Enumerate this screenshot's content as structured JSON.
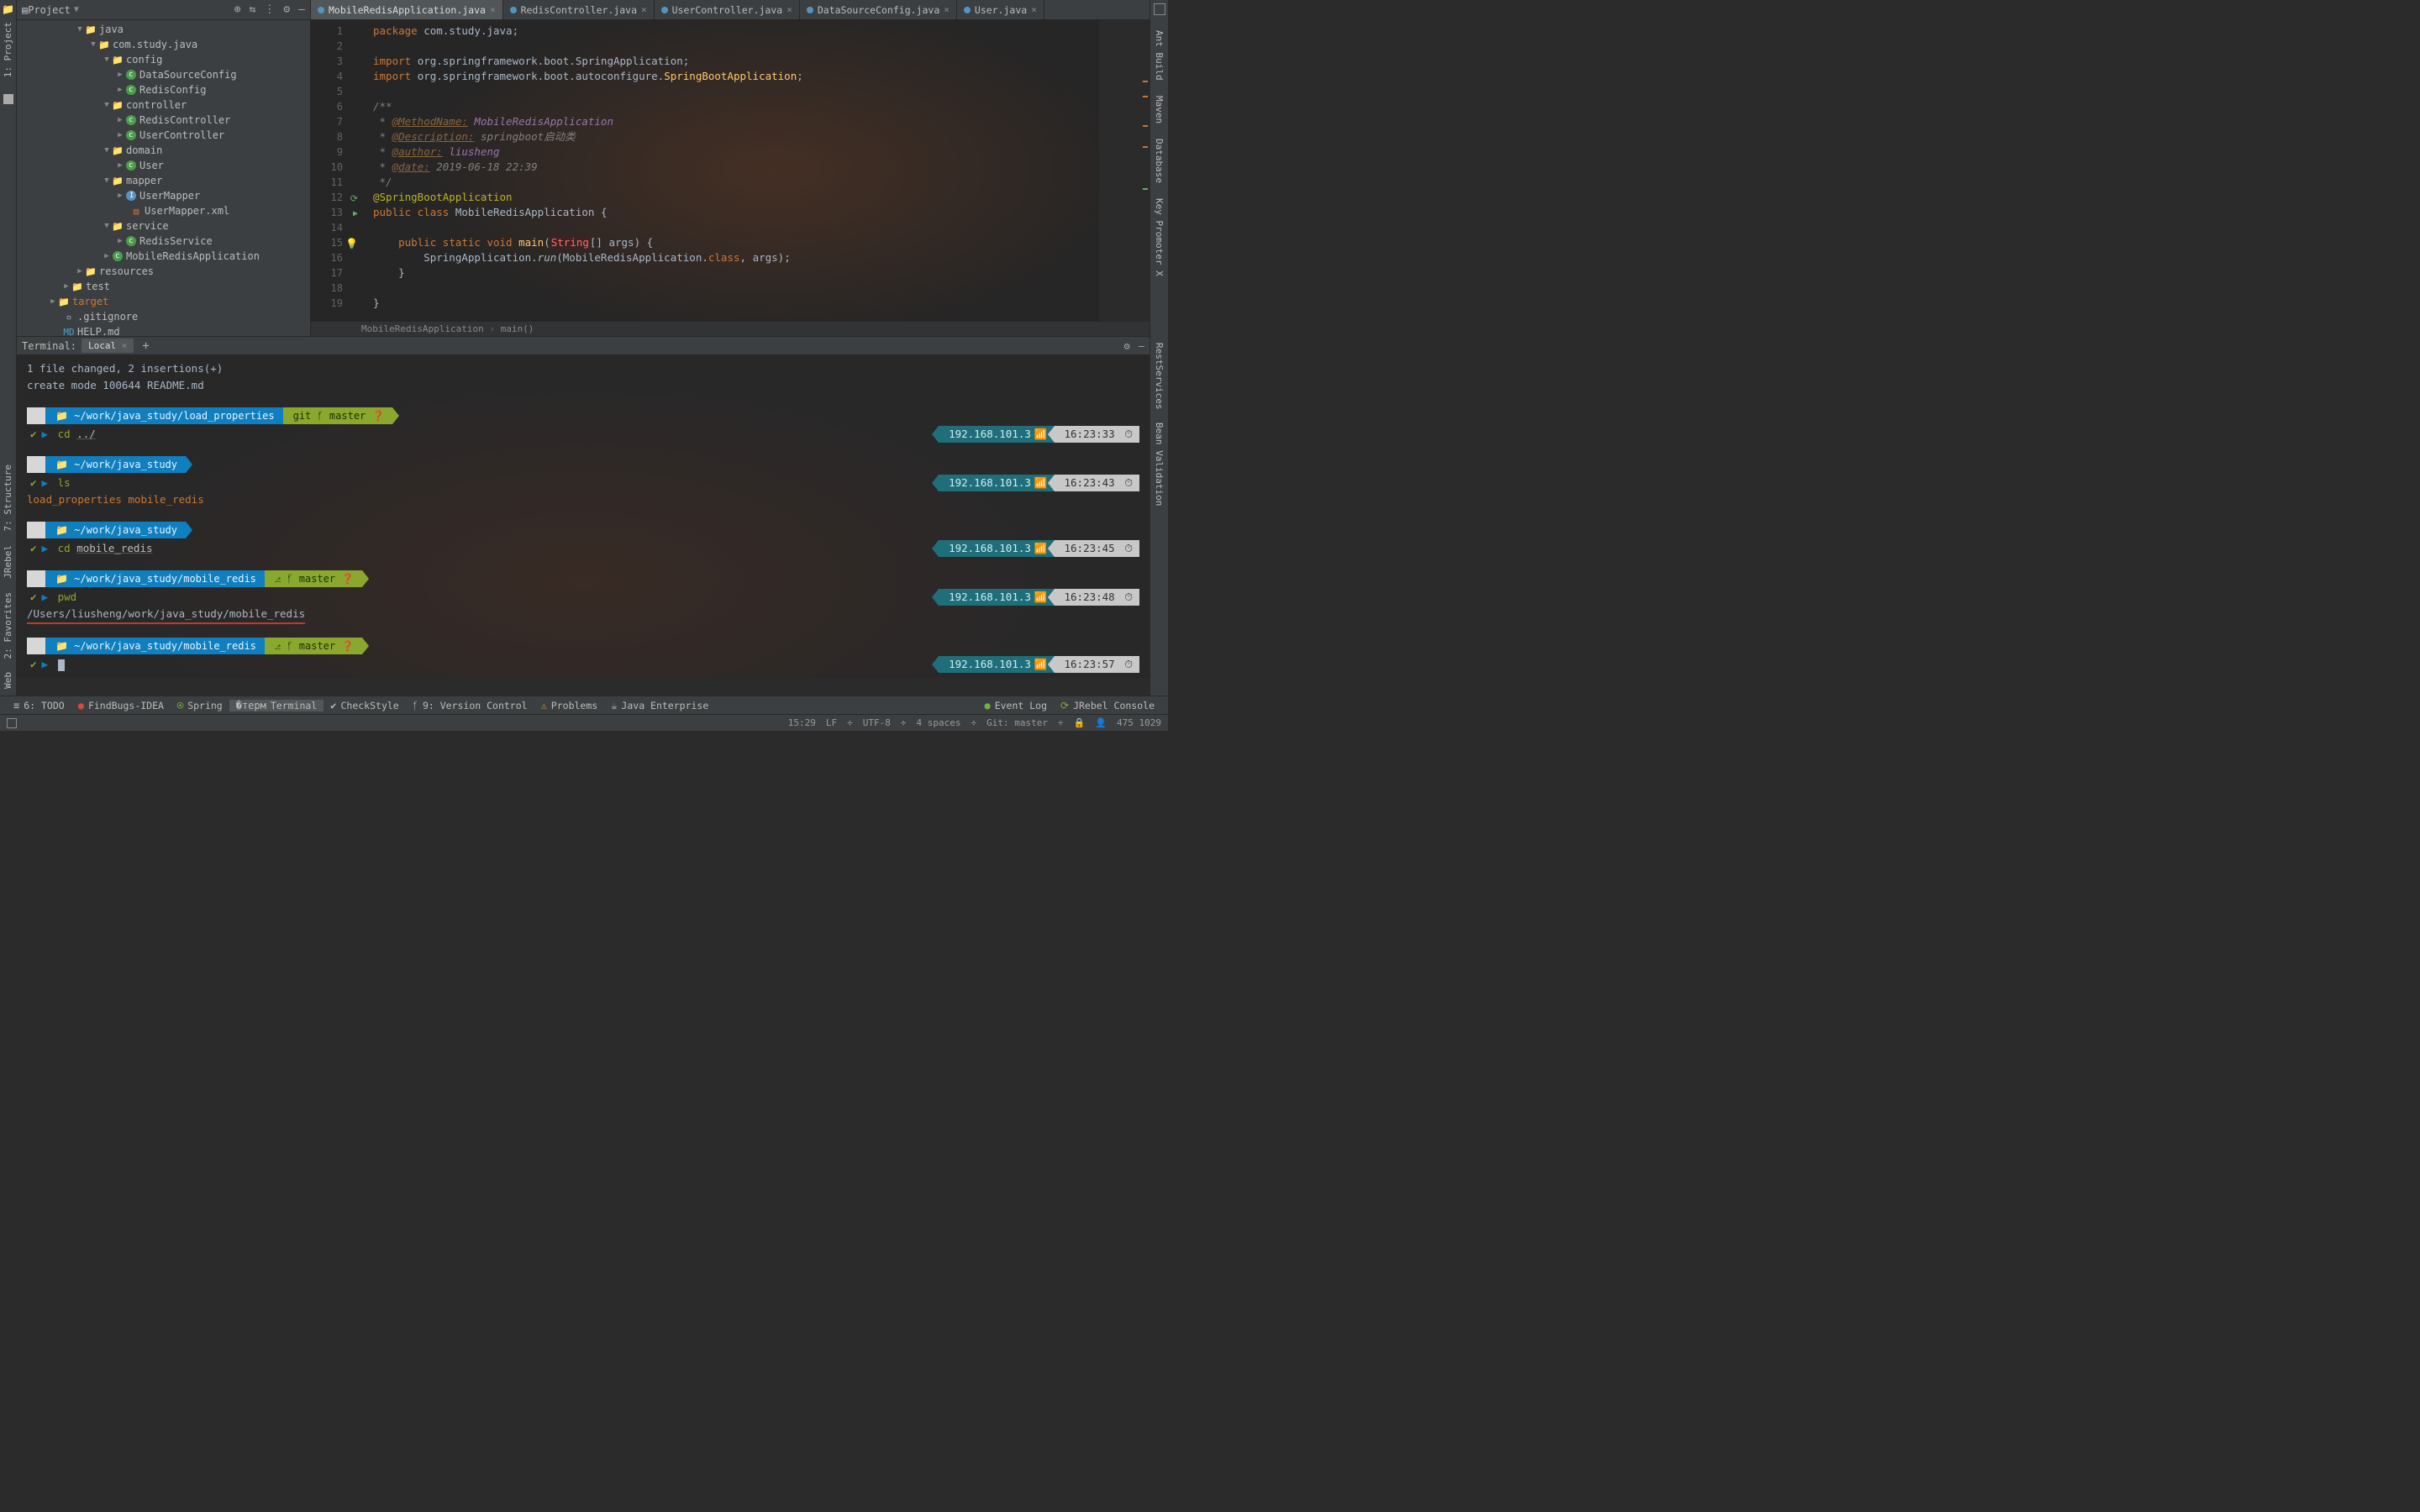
{
  "project": {
    "title": "Project",
    "tree": {
      "java": "java",
      "pkg": "com.study.java",
      "config": "config",
      "config_items": [
        "DataSourceConfig",
        "RedisConfig"
      ],
      "controller": "controller",
      "controller_items": [
        "RedisController",
        "UserController"
      ],
      "domain": "domain",
      "domain_items": [
        "User"
      ],
      "mapper": "mapper",
      "mapper_items": [
        "UserMapper",
        "UserMapper.xml"
      ],
      "service": "service",
      "service_items": [
        "RedisService"
      ],
      "app": "MobileRedisApplication",
      "resources": "resources",
      "test": "test",
      "target": "target",
      "gitignore": ".gitignore",
      "helpmd": "HELP.md"
    }
  },
  "left_tools": {
    "project": "1: Project"
  },
  "left_lower_tools": [
    "7: Structure",
    "JRebel",
    "2: Favorites",
    "Web"
  ],
  "right_tools_upper": [
    "Ant Build",
    "Maven",
    "Database",
    "Key Promoter X"
  ],
  "right_tools_lower": [
    "RestServices",
    "Bean Validation"
  ],
  "tabs": [
    {
      "label": "MobileRedisApplication.java",
      "active": true
    },
    {
      "label": "RedisController.java"
    },
    {
      "label": "UserController.java"
    },
    {
      "label": "DataSourceConfig.java"
    },
    {
      "label": "User.java"
    }
  ],
  "code": {
    "lines": [
      "1",
      "2",
      "3",
      "4",
      "5",
      "6",
      "7",
      "8",
      "9",
      "10",
      "11",
      "12",
      "13",
      "14",
      "15",
      "16",
      "17",
      "18",
      "19"
    ],
    "l1": "package com.study.java;",
    "l3a": "import org.springframework.boot.SpringApplication;",
    "l4a": "import org.springframework.boot.autoconfigure.",
    "l4b": "SpringBootApplication",
    "l4c": ";",
    "l6": "/**",
    "l7a": " * @MethodName:",
    "l7b": " MobileRedisApplication",
    "l8a": " * @Description:",
    "l8b": " springboot启动类",
    "l9a": " * @author:",
    "l9b": " liusheng",
    "l10a": " * @date:",
    "l10b": " 2019-06-18 22:39",
    "l11": " */",
    "l12": "@SpringBootApplication",
    "l13": "public class MobileRedisApplication {",
    "l15a": "public static void ",
    "l15b": "main",
    "l15c": "String",
    "l15d": "[] args) {",
    "l16": "        SpringApplication.run(MobileRedisApplication.class, args);",
    "l17": "    }",
    "l19": "}"
  },
  "breadcrumb": {
    "a": "MobileRedisApplication",
    "b": "main()"
  },
  "terminal": {
    "title": "Terminal:",
    "tab": "Local",
    "out1": " 1 file changed, 2 insertions(+)",
    "out2": " create mode 100644 README.md",
    "prompts": [
      {
        "path": "~/work/java_study/load_properties",
        "git": "master",
        "cmd": "cd",
        "arg": "../",
        "ip": "192.168.101.3",
        "time": "16:23:33"
      },
      {
        "path": "~/work/java_study",
        "cmd": "ls",
        "out": "load_properties mobile_redis",
        "ip": "192.168.101.3",
        "time": "16:23:43"
      },
      {
        "path": "~/work/java_study",
        "cmd": "cd",
        "arg": "mobile_redis",
        "ip": "192.168.101.3",
        "time": "16:23:45"
      },
      {
        "path": "~/work/java_study/mobile_redis",
        "git": "master",
        "cmd": "pwd",
        "out": "/Users/liusheng/work/java_study/mobile_redis",
        "ip": "192.168.101.3",
        "time": "16:23:48",
        "redline": true
      },
      {
        "path": "~/work/java_study/mobile_redis",
        "git": "master",
        "ip": "192.168.101.3",
        "time": "16:23:57",
        "cursor": true
      }
    ]
  },
  "bottom_tools": {
    "todo": "6: TODO",
    "findbugs": "FindBugs-IDEA",
    "spring": "Spring",
    "terminal": "Terminal",
    "checkstyle": "CheckStyle",
    "vcs": "9: Version Control",
    "problems": "Problems",
    "javaee": "Java Enterprise",
    "eventlog": "Event Log",
    "jrebel": "JRebel Console"
  },
  "status": {
    "pos": "15:29",
    "lf": "LF",
    "enc": "UTF-8",
    "indent": "4 spaces",
    "git": "Git: master",
    "right": "475      1029"
  }
}
